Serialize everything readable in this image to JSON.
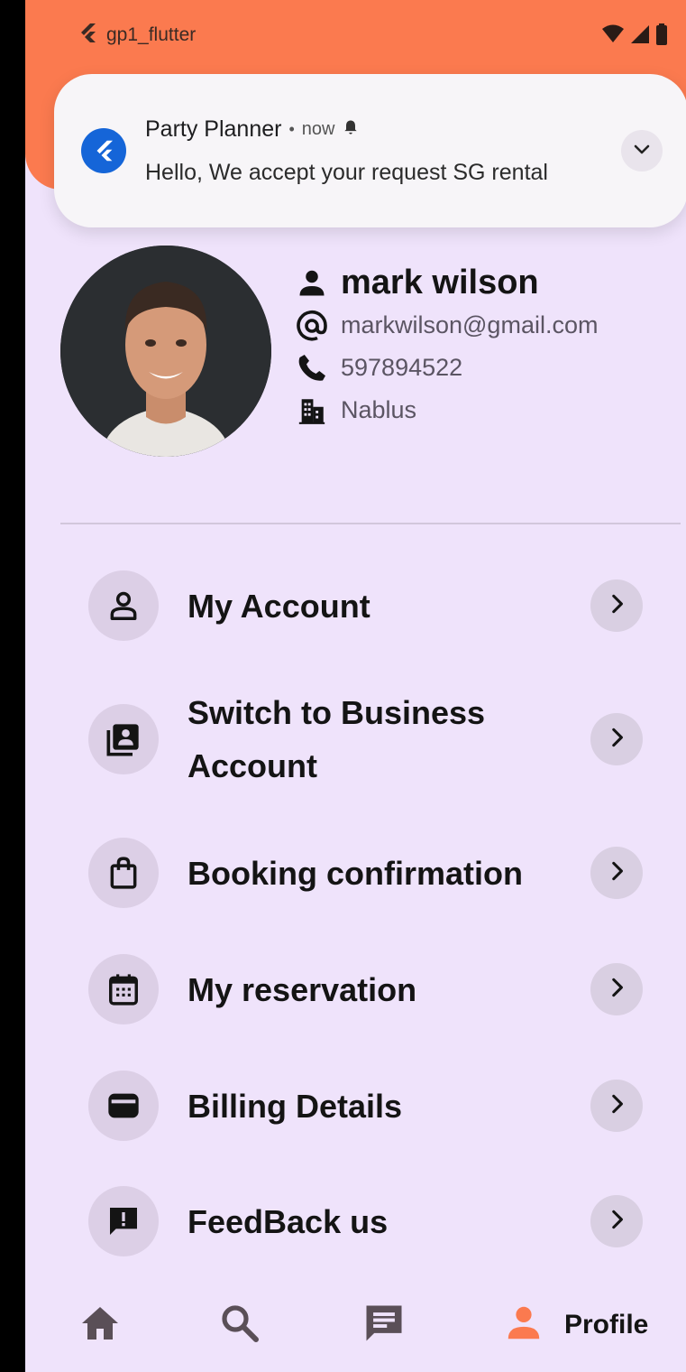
{
  "statusbar": {
    "app_name": "gp1_flutter"
  },
  "notification": {
    "app": "Party Planner",
    "separator": "•",
    "time": "now",
    "message": "Hello, We accept your request SG rental"
  },
  "profile": {
    "name": "mark wilson",
    "email": "markwilson@gmail.com",
    "phone": "597894522",
    "city": "Nablus"
  },
  "menu": {
    "my_account": "My Account",
    "switch_business_line1": "Switch to Business",
    "switch_business_line2": "Account",
    "booking": "Booking confirmation",
    "reservation": "My reservation",
    "billing": "Billing Details",
    "feedback": "FeedBack us"
  },
  "bottom_nav": {
    "profile_label": "Profile",
    "active": "profile"
  },
  "colors": {
    "header": "#fb7a4f",
    "background": "#efe3fb",
    "active_nav": "#fb7a4f",
    "notification_icon": "#1565d8"
  },
  "icons": [
    "flutter-icon",
    "wifi-icon",
    "signal-icon",
    "battery-icon",
    "person-icon",
    "at-icon",
    "phone-icon",
    "building-icon",
    "account-icon",
    "business-card-icon",
    "shopping-bag-icon",
    "calendar-icon",
    "wallet-icon",
    "feedback-icon",
    "chevron-right-icon",
    "home-icon",
    "search-icon",
    "chat-icon",
    "profile-icon"
  ]
}
